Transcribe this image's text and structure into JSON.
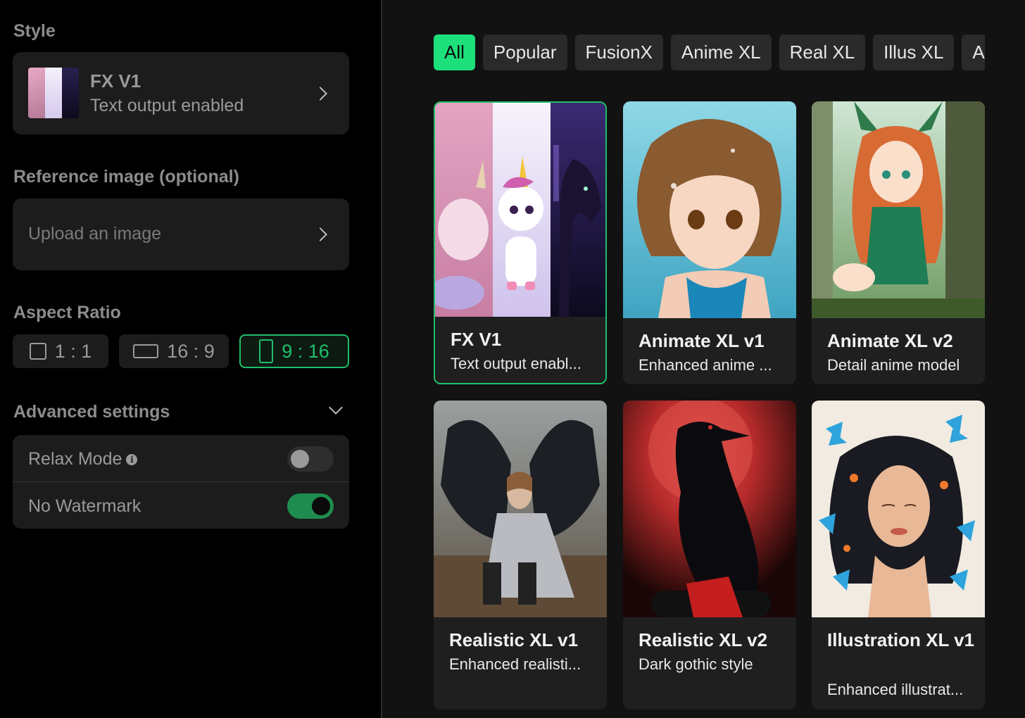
{
  "sidebar": {
    "style": {
      "label": "Style",
      "selected_title": "FX V1",
      "selected_subtitle": "Text output enabled"
    },
    "reference": {
      "label": "Reference image (optional)",
      "placeholder": "Upload an image"
    },
    "aspect": {
      "label": "Aspect Ratio",
      "options": [
        "1 : 1",
        "16 : 9",
        "9 : 16"
      ],
      "selected": "9 : 16"
    },
    "advanced": {
      "label": "Advanced settings",
      "relax_label": "Relax Mode",
      "relax_on": false,
      "watermark_label": "No Watermark",
      "watermark_on": true
    }
  },
  "filters": [
    "All",
    "Popular",
    "FusionX",
    "Anime XL",
    "Real XL",
    "Illus XL",
    "A"
  ],
  "active_filter": "All",
  "models": [
    {
      "title": "FX V1",
      "subtitle": "Text output enabl...",
      "selected": true
    },
    {
      "title": "Animate XL v1",
      "subtitle": "Enhanced anime ...",
      "selected": false
    },
    {
      "title": "Animate XL v2",
      "subtitle": "Detail anime model",
      "selected": false
    },
    {
      "title": "Realistic XL v1",
      "subtitle": "Enhanced realisti...",
      "selected": false
    },
    {
      "title": "Realistic XL v2",
      "subtitle": "Dark gothic style",
      "selected": false
    },
    {
      "title": "Illustration XL v1",
      "subtitle": "Enhanced illustrat...",
      "selected": false
    }
  ],
  "colors": {
    "accent": "#1ee07a",
    "panel": "#1c1c1c",
    "background": "#000000"
  }
}
